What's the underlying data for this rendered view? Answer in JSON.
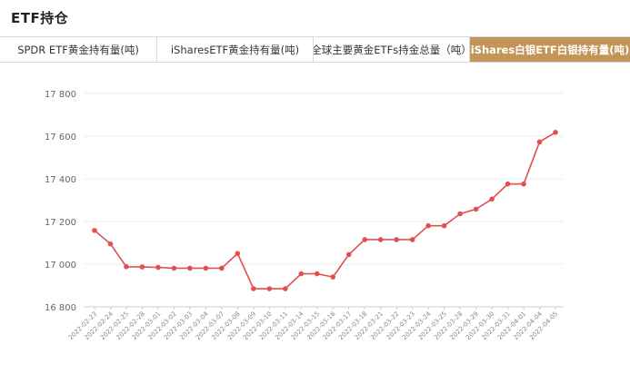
{
  "page": {
    "title": "ETF持仓"
  },
  "tabs": [
    {
      "label": "SPDR ETF黄金持有量(吨)",
      "active": false
    },
    {
      "label": "iSharesETF黄金持有量(吨)",
      "active": false
    },
    {
      "label": "全球主要黄金ETFs持金总量（吨）",
      "active": false
    },
    {
      "label": "iShares白银ETF白银持有量(吨)",
      "active": true
    }
  ],
  "colors": {
    "accent": "#c39559",
    "series": "#e05050",
    "grid": "#eeeeee",
    "axis_text": "#666666"
  },
  "chart_data": {
    "type": "line",
    "x": [
      "2022-02-23",
      "2022-02-24",
      "2022-02-25",
      "2022-02-28",
      "2022-03-01",
      "2022-03-02",
      "2022-03-03",
      "2022-03-04",
      "2022-03-07",
      "2022-03-08",
      "2022-03-09",
      "2022-03-10",
      "2022-03-11",
      "2022-03-14",
      "2022-03-15",
      "2022-03-16",
      "2022-03-17",
      "2022-03-18",
      "2022-03-21",
      "2022-03-22",
      "2022-03-23",
      "2022-03-24",
      "2022-03-25",
      "2022-03-28",
      "2022-03-29",
      "2022-03-30",
      "2022-03-31",
      "2022-04-01",
      "2022-04-04",
      "2022-04-05"
    ],
    "series": [
      {
        "values": [
          17158,
          17095,
          16988,
          16987,
          16985,
          16981,
          16981,
          16981,
          16981,
          17050,
          16885,
          16885,
          16885,
          16955,
          16955,
          16940,
          17045,
          17115,
          17115,
          17115,
          17115,
          17180,
          17180,
          17236,
          17258,
          17305,
          17376,
          17376,
          17573,
          17618
        ]
      }
    ],
    "yticks": [
      16800,
      17000,
      17200,
      17400,
      17600,
      17800
    ],
    "ytick_labels": [
      "16 800",
      "17 000",
      "17 200",
      "17 400",
      "17 600",
      "17 800"
    ],
    "ylim": [
      16800,
      17800
    ],
    "grid": true
  }
}
